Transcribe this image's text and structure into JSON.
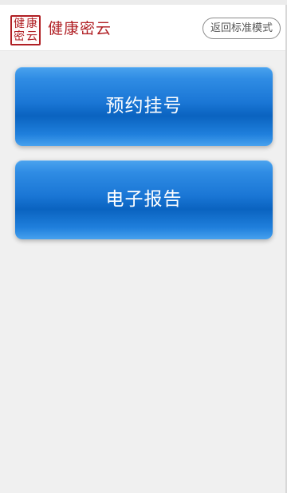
{
  "header": {
    "logo_chars": [
      "健",
      "康",
      "密",
      "云"
    ],
    "title": "健康密云",
    "back_label": "返回标准模式"
  },
  "menu": {
    "items": [
      {
        "label": "预约挂号"
      },
      {
        "label": "电子报告"
      }
    ]
  },
  "colors": {
    "brand_red": "#b01f24",
    "button_blue": "#1a76d5",
    "background": "#f0f0f0"
  }
}
